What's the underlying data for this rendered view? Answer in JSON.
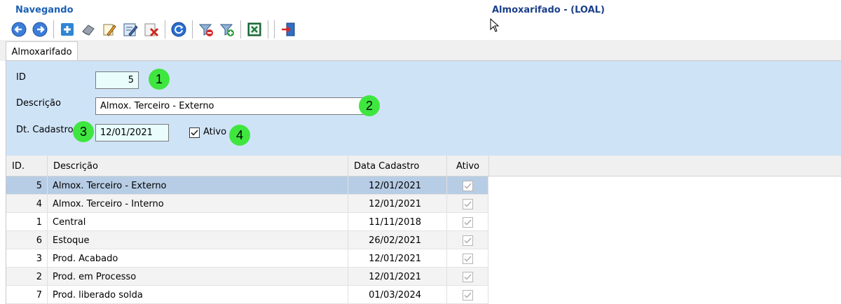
{
  "header": {
    "status": "Navegando",
    "form_title": "Almoxarifado - (LOAL)"
  },
  "toolbar": {
    "buttons": [
      "back-arrow-icon",
      "forward-arrow-icon",
      "new-record-icon",
      "eraser-icon",
      "edit-pencil-icon",
      "edit-form-icon",
      "delete-icon",
      "refresh-icon",
      "filter-remove-icon",
      "filter-add-icon",
      "excel-export-icon",
      "exit-door-icon"
    ]
  },
  "tabs": [
    {
      "label": "Almoxarifado"
    }
  ],
  "form": {
    "id_label": "ID",
    "id_value": "5",
    "descricao_label": "Descrição",
    "descricao_value": "Almox. Terceiro - Externo",
    "dt_cadastro_label": "Dt. Cadastro",
    "dt_cadastro_value": "12/01/2021",
    "ativo_label": "Ativo",
    "ativo_checked": true
  },
  "badges": [
    "1",
    "2",
    "3",
    "4"
  ],
  "grid": {
    "columns": [
      "ID.",
      "Descrição",
      "Data Cadastro",
      "Ativo"
    ],
    "rows": [
      {
        "id": "5",
        "descricao": "Almox. Terceiro - Externo",
        "data": "12/01/2021",
        "ativo": true
      },
      {
        "id": "4",
        "descricao": "Almox. Terceiro - Interno",
        "data": "12/01/2021",
        "ativo": true
      },
      {
        "id": "1",
        "descricao": "Central",
        "data": "11/11/2018",
        "ativo": true
      },
      {
        "id": "6",
        "descricao": "Estoque",
        "data": "26/02/2021",
        "ativo": true
      },
      {
        "id": "3",
        "descricao": "Prod. Acabado",
        "data": "12/01/2021",
        "ativo": true
      },
      {
        "id": "2",
        "descricao": "Prod. em Processo",
        "data": "12/01/2021",
        "ativo": true
      },
      {
        "id": "7",
        "descricao": "Prod. liberado solda",
        "data": "01/03/2024",
        "ativo": true
      }
    ]
  },
  "colors": {
    "status_title": "#1a5fb4",
    "form_panel": "#cfe3f7",
    "selected_row": "#b7cde5",
    "badge": "#3fe63f"
  }
}
